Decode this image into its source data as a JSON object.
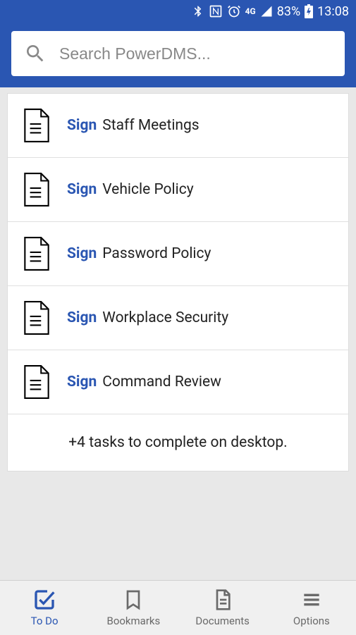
{
  "status": {
    "network": "4G",
    "battery": "83%",
    "time": "13:08"
  },
  "search": {
    "placeholder": "Search PowerDMS..."
  },
  "items": [
    {
      "action": "Sign",
      "title": "Staff Meetings"
    },
    {
      "action": "Sign",
      "title": "Vehicle Policy"
    },
    {
      "action": "Sign",
      "title": "Password Policy"
    },
    {
      "action": "Sign",
      "title": "Workplace Security"
    },
    {
      "action": "Sign",
      "title": "Command Review"
    }
  ],
  "footer_message": "+4 tasks to complete on desktop.",
  "nav": {
    "todo": "To Do",
    "bookmarks": "Bookmarks",
    "documents": "Documents",
    "options": "Options"
  }
}
